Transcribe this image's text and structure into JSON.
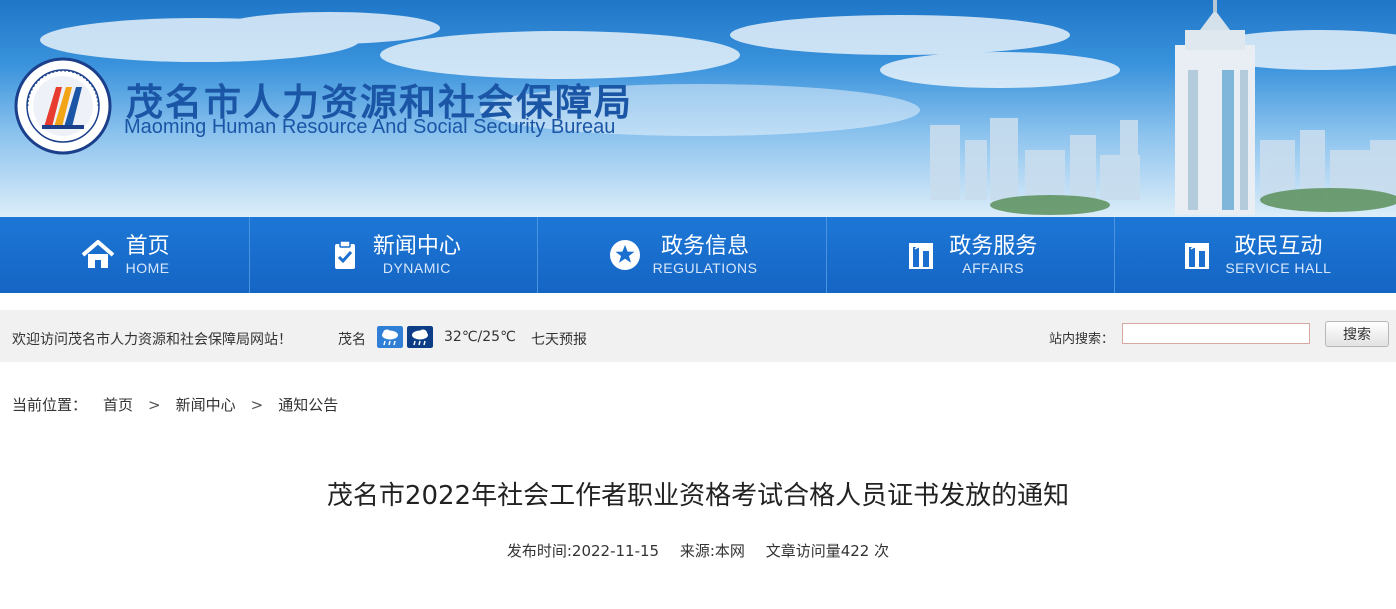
{
  "header": {
    "title_cn": "茂名市人力资源和社会保障局",
    "title_en": "Maoming Human Resource And Social Security Bureau",
    "emblem_text": "茂名市人力资源和社会保障局"
  },
  "nav": [
    {
      "cn": "首页",
      "en": "HOME",
      "icon": "home-icon"
    },
    {
      "cn": "新闻中心",
      "en": "DYNAMIC",
      "icon": "clipboard-check-icon"
    },
    {
      "cn": "政务信息",
      "en": "REGULATIONS",
      "icon": "star-circle-icon"
    },
    {
      "cn": "政务服务",
      "en": "AFFAIRS",
      "icon": "building-icon"
    },
    {
      "cn": "政民互动",
      "en": "SERVICE HALL",
      "icon": "building-icon"
    }
  ],
  "infobar": {
    "welcome": "欢迎访问茂名市人力资源和社会保障局网站！",
    "city": "茂名",
    "temperature": "32℃/25℃",
    "forecast": "七天预报",
    "weather_icons": [
      "rain-cloud-icon",
      "night-rain-cloud-icon"
    ],
    "search_label": "站内搜索：",
    "search_value": "",
    "search_button": "搜索"
  },
  "breadcrumb": {
    "prefix": "当前位置：",
    "items": [
      "首页",
      "新闻中心",
      "通知公告"
    ],
    "separator": ">"
  },
  "article": {
    "title": "茂名市2022年社会工作者职业资格考试合格人员证书发放的通知",
    "publish": "发布时间:2022-11-15",
    "source": "来源:本网",
    "views": "文章访问量422 次"
  },
  "colors": {
    "nav_bg": "#1a6fcf",
    "title_blue": "#1b56a6",
    "infobar_bg": "#f1f1f1"
  }
}
